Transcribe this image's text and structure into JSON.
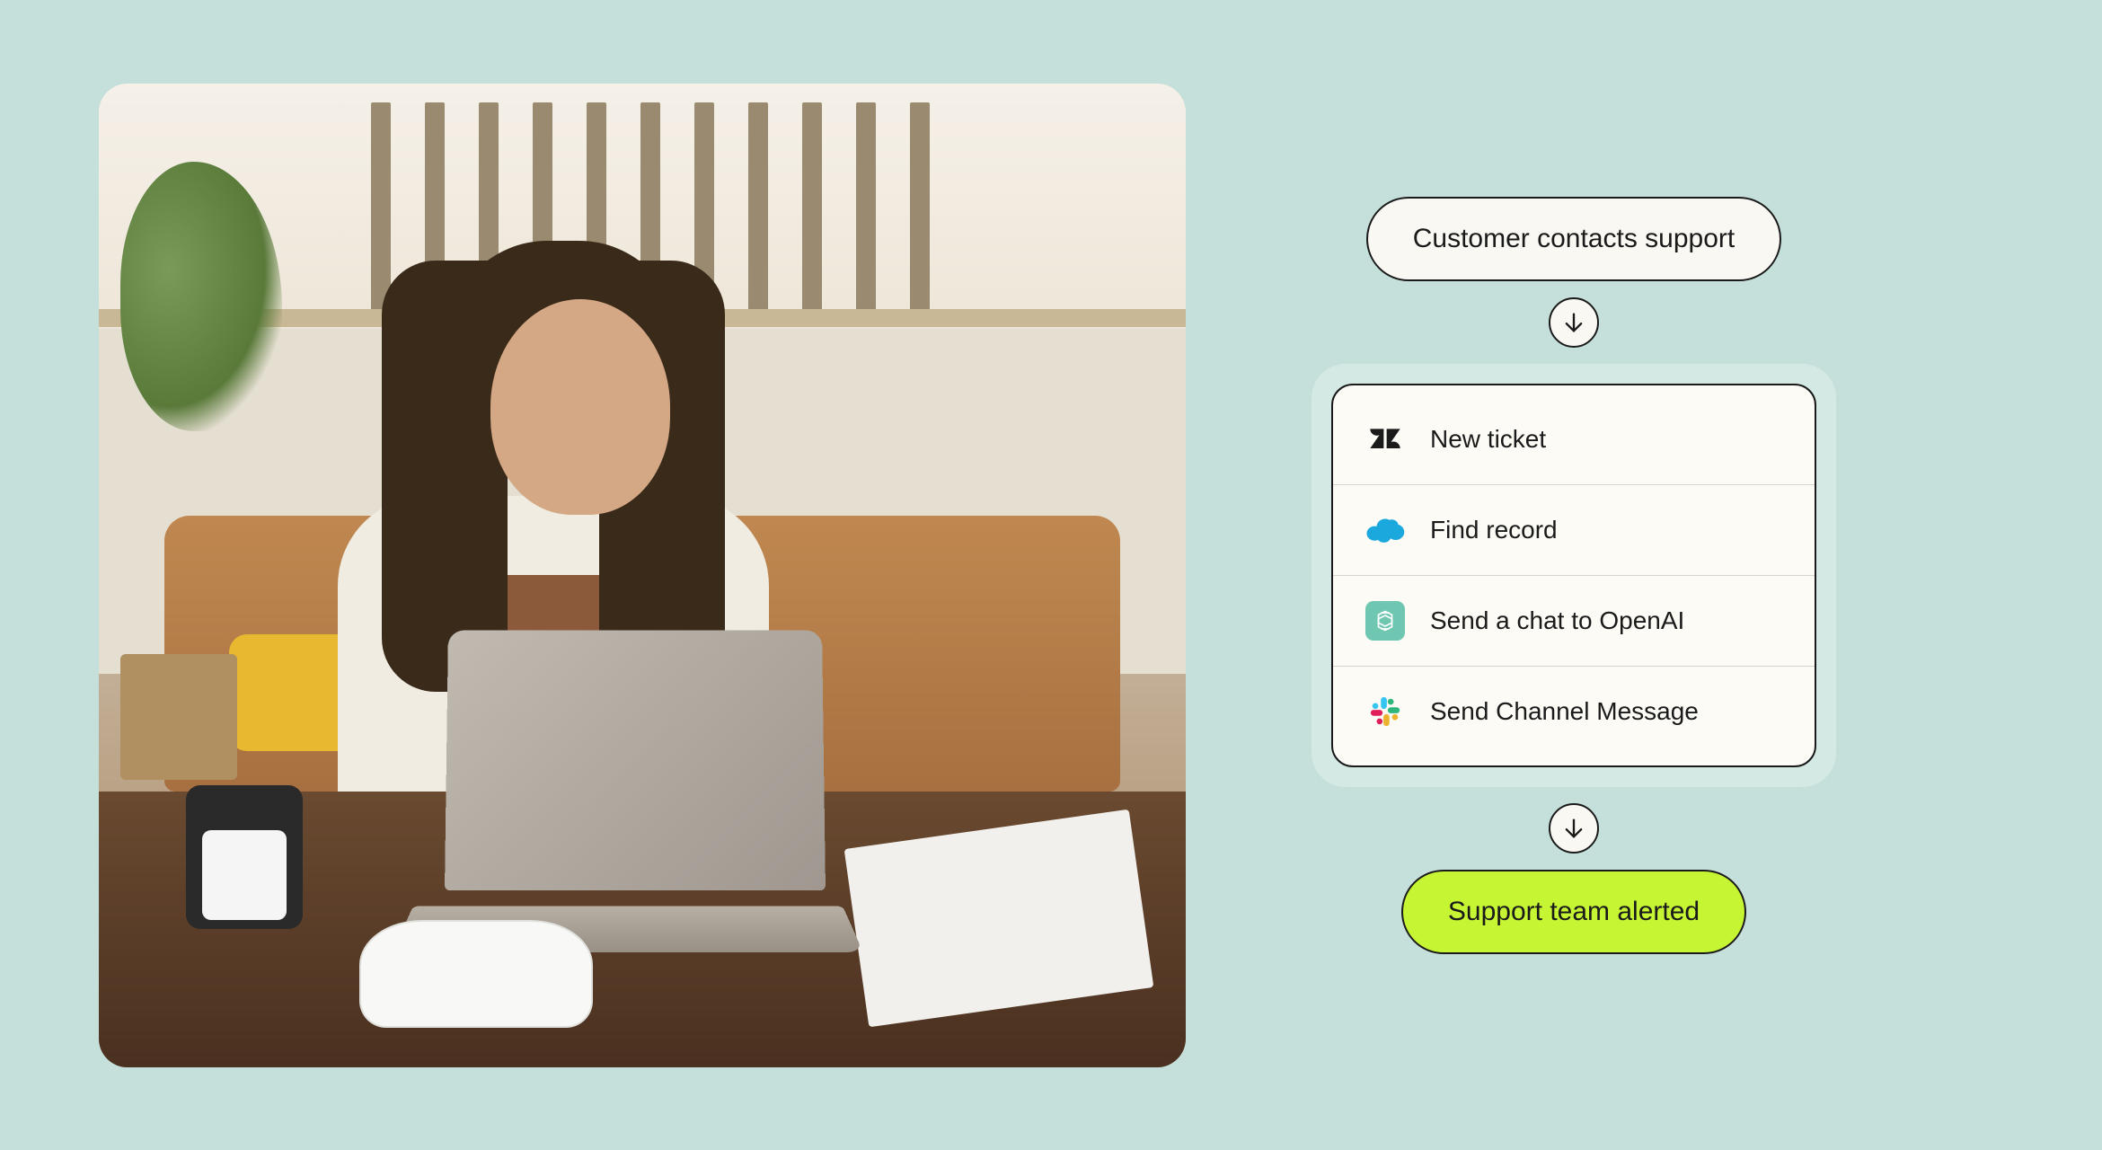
{
  "flow": {
    "trigger": "Customer contacts support",
    "result": "Support team alerted",
    "steps": [
      {
        "icon": "zendesk",
        "label": "New ticket"
      },
      {
        "icon": "salesforce",
        "label": "Find record"
      },
      {
        "icon": "openai",
        "label": "Send a chat to OpenAI"
      },
      {
        "icon": "slack",
        "label": "Send Channel Message"
      }
    ]
  },
  "colors": {
    "page_bg": "#c5e0db",
    "card_bg": "#fcfbf6",
    "card_outer": "#d4e9e4",
    "pill_bg": "#faf8f2",
    "result_bg": "#c6f534",
    "border": "#1a1a1a"
  },
  "photo": {
    "description": "Woman with long dark hair wearing white top and brown overalls, smiling, using earbuds, working on silver laptop at wooden desk; tan leather tufted couch, yellow pillow, window with bars, potted plant, phone on stand, face mask and papers on desk"
  }
}
